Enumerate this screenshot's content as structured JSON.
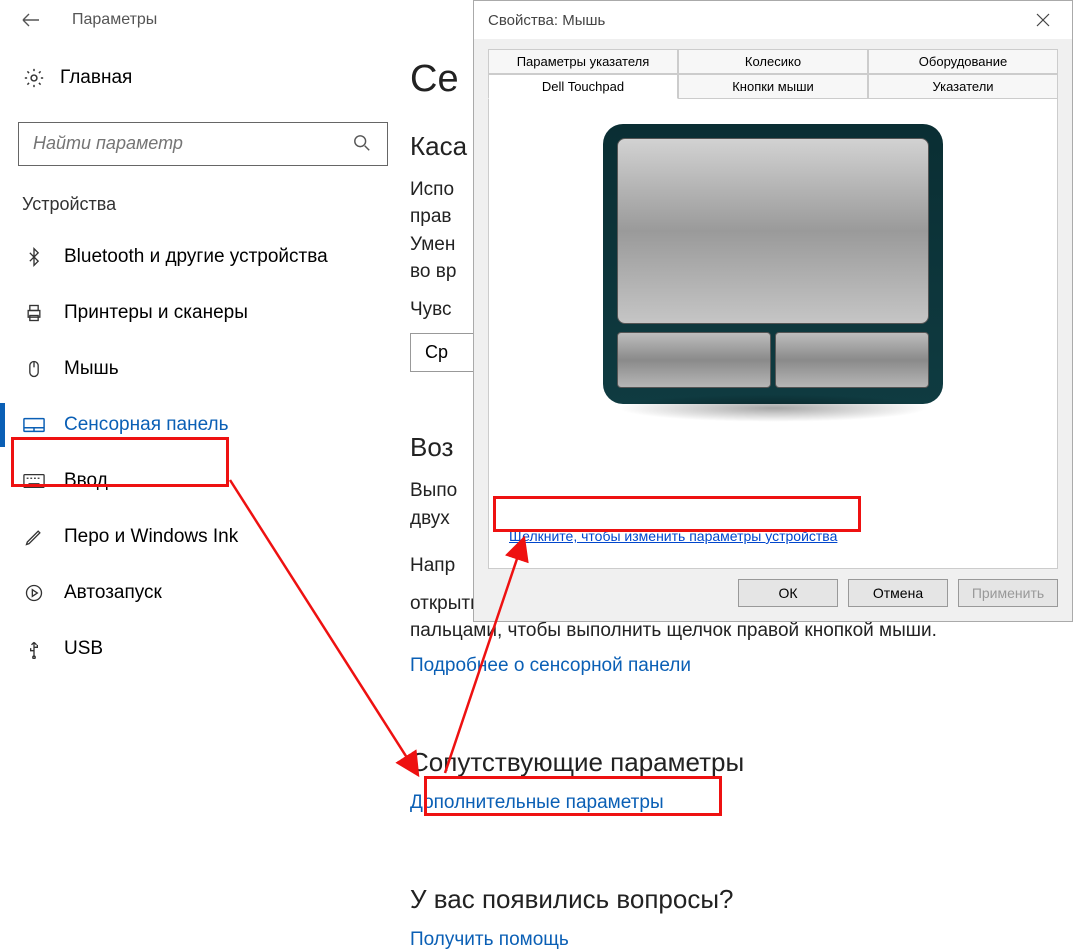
{
  "settings": {
    "header_title": "Параметры",
    "home_label": "Главная",
    "search_placeholder": "Найти параметр",
    "group_title": "Устройства",
    "sidebar": [
      {
        "icon": "bluetooth",
        "label": "Bluetooth и другие устройства"
      },
      {
        "icon": "printer",
        "label": "Принтеры и сканеры"
      },
      {
        "icon": "mouse",
        "label": "Мышь"
      },
      {
        "icon": "touchpad",
        "label": "Сенсорная панель",
        "active": true
      },
      {
        "icon": "keyboard",
        "label": "Ввод"
      },
      {
        "icon": "pen",
        "label": "Перо и Windows Ink"
      },
      {
        "icon": "autoplay",
        "label": "Автозапуск"
      },
      {
        "icon": "usb",
        "label": "USB"
      }
    ]
  },
  "main": {
    "title_prefix": "Се",
    "h2_1": "Каса",
    "p1a": "Испо",
    "p1b": "прав",
    "p1c": "Умен",
    "p1d": "во вр",
    "sens_label": "Чувс",
    "sens_value": "Ср",
    "h2_2": "Воз",
    "p2a": "Выпо",
    "p2b": "двух",
    "p2c": "Напр",
    "p3": "открытые приложения, или один раз коснитесь приложения двумя пальцами, чтобы выполнить щелчок правой кнопкой мыши.",
    "link_more": "Подробнее о сенсорной панели",
    "h2_3": "Сопутствующие параметры",
    "link_extra": "Дополнительные параметры",
    "h2_4": "У вас появились вопросы?",
    "link_help": "Получить помощь"
  },
  "dialog": {
    "title": "Свойства: Мышь",
    "tabs_row1": [
      "Параметры указателя",
      "Колесико",
      "Оборудование"
    ],
    "tabs_row2": [
      "Dell Touchpad",
      "Кнопки мыши",
      "Указатели"
    ],
    "active_tab": "Dell Touchpad",
    "device_link": "Щелкните, чтобы изменить параметры устройства ",
    "btn_ok": "ОК",
    "btn_cancel": "Отмена",
    "btn_apply": "Применить"
  }
}
